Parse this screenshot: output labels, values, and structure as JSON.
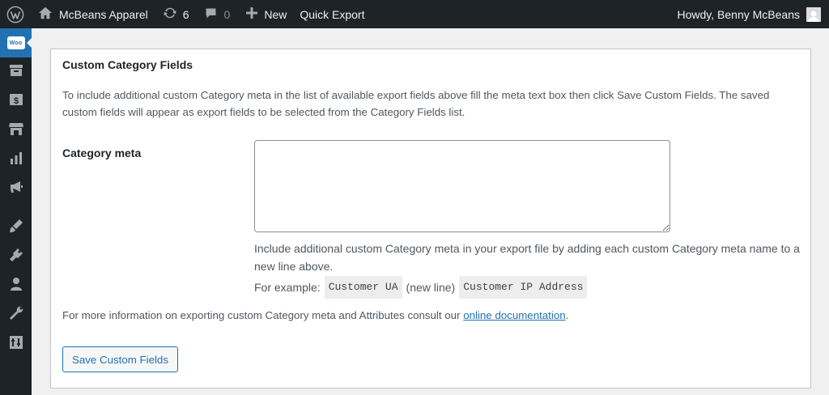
{
  "adminbar": {
    "site_name": "McBeans Apparel",
    "updates_count": "6",
    "comments_count": "0",
    "new_label": "New",
    "quick_export_label": "Quick Export",
    "howdy": "Howdy, Benny McBeans"
  },
  "sidebar": {
    "woo_badge": "Woo",
    "items": [
      {
        "icon": "woocommerce-icon",
        "active": true
      },
      {
        "icon": "archive-icon"
      },
      {
        "icon": "money-icon"
      },
      {
        "icon": "store-icon"
      },
      {
        "icon": "chart-icon"
      },
      {
        "icon": "megaphone-icon"
      },
      {
        "icon": "appearance-icon"
      },
      {
        "icon": "plugins-icon"
      },
      {
        "icon": "users-icon"
      },
      {
        "icon": "tools-icon"
      },
      {
        "icon": "settings-icon"
      }
    ]
  },
  "panel": {
    "title": "Custom Category Fields",
    "description": "To include additional custom Category meta in the list of available export fields above fill the meta text box then click Save Custom Fields. The saved custom fields will appear as export fields to be selected from the Category Fields list.",
    "meta_label": "Category meta",
    "textarea_value": "",
    "help_text": "Include additional custom Category meta in your export file by adding each custom Category meta name to a new line above.",
    "example_prefix": "For example:",
    "example_code_1": "Customer UA",
    "example_between": "(new line)",
    "example_code_2": "Customer IP Address",
    "more_info_prefix": "For more information on exporting custom Category meta and Attributes consult our",
    "more_info_link": "online documentation",
    "more_info_suffix": ".",
    "save_button": "Save Custom Fields"
  },
  "colors": {
    "adminbar_bg": "#1d2327",
    "accent": "#2271b1",
    "page_bg": "#f0f0f1"
  }
}
